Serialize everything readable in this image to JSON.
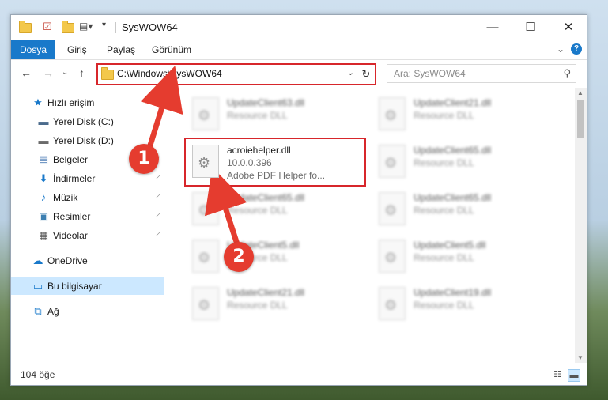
{
  "window": {
    "title": "SysWOW64",
    "controls": {
      "minimize": "—",
      "maximize": "☐",
      "close": "✕"
    }
  },
  "ribbon": {
    "file_tab": "Dosya",
    "tabs": [
      "Giriş",
      "Paylaş",
      "Görünüm"
    ],
    "collapse_glyph": "⌄",
    "help_glyph": "?"
  },
  "navigation": {
    "back": "←",
    "forward": "→",
    "recent": "⌄",
    "up": "↑",
    "address": "C:\\Windows\\SysWOW64",
    "address_dropdown": "⌄",
    "refresh": "↻",
    "search_placeholder": "Ara: SysWOW64",
    "search_icon": "search-icon"
  },
  "sidebar": {
    "items": [
      {
        "label": "Hızlı erişim",
        "icon": "star-icon",
        "glyph": "★",
        "color": "#1979ca",
        "pinned": false
      },
      {
        "label": "Yerel Disk (C:)",
        "icon": "drive-icon",
        "glyph": "▬",
        "color": "#4b6b8c",
        "pinned": false
      },
      {
        "label": "Yerel Disk (D:)",
        "icon": "drive-icon",
        "glyph": "▬",
        "color": "#6b6b6b",
        "pinned": false
      },
      {
        "label": "Belgeler",
        "icon": "documents-icon",
        "glyph": "▤",
        "color": "#4a7bb5",
        "pinned": true
      },
      {
        "label": "İndirmeler",
        "icon": "download-icon",
        "glyph": "⬇",
        "color": "#1979ca",
        "pinned": true
      },
      {
        "label": "Müzik",
        "icon": "music-icon",
        "glyph": "♪",
        "color": "#1979ca",
        "pinned": true
      },
      {
        "label": "Resimler",
        "icon": "pictures-icon",
        "glyph": "▣",
        "color": "#3c7fb1",
        "pinned": true
      },
      {
        "label": "Videolar",
        "icon": "videos-icon",
        "glyph": "▦",
        "color": "#555555",
        "pinned": true
      },
      {
        "label": "OneDrive",
        "icon": "cloud-icon",
        "glyph": "☁",
        "color": "#1979ca",
        "pinned": false
      },
      {
        "label": "Bu bilgisayar",
        "icon": "computer-icon",
        "glyph": "▭",
        "color": "#1979ca",
        "pinned": false,
        "selected": true
      },
      {
        "label": "Ağ",
        "icon": "network-icon",
        "glyph": "⧉",
        "color": "#1979ca",
        "pinned": false
      }
    ],
    "pin_glyph": "📌"
  },
  "files": [
    {
      "name": "UpdateClient63.dll",
      "type": "Resource DLL",
      "blurred": true
    },
    {
      "name": "UpdateClient21.dll",
      "type": "Resource DLL",
      "blurred": true
    },
    {
      "name": "acroiehelper.dll",
      "version": "10.0.0.396",
      "description": "Adobe PDF Helper fo...",
      "blurred": false,
      "highlighted": true
    },
    {
      "name": "UpdateClient65.dll",
      "type": "Resource DLL",
      "blurred": true
    },
    {
      "name": "UpdateClient65.dll",
      "type": "Resource DLL",
      "blurred": true
    },
    {
      "name": "UpdateClient65.dll",
      "type": "Resource DLL",
      "blurred": true
    },
    {
      "name": "UpdateClient5.dll",
      "type": "Resource DLL",
      "blurred": true
    },
    {
      "name": "UpdateClient5.dll",
      "type": "Resource DLL",
      "blurred": true
    },
    {
      "name": "UpdateClient21.dll",
      "type": "Resource DLL",
      "blurred": true
    },
    {
      "name": "UpdateClient19.dll",
      "type": "Resource DLL",
      "blurred": true
    }
  ],
  "status": {
    "item_count": "104 öğe",
    "details_view_glyph": "☷",
    "tiles_view_glyph": "▬"
  },
  "annotations": {
    "step1": "1",
    "step2": "2",
    "color": "#e53c2f"
  }
}
